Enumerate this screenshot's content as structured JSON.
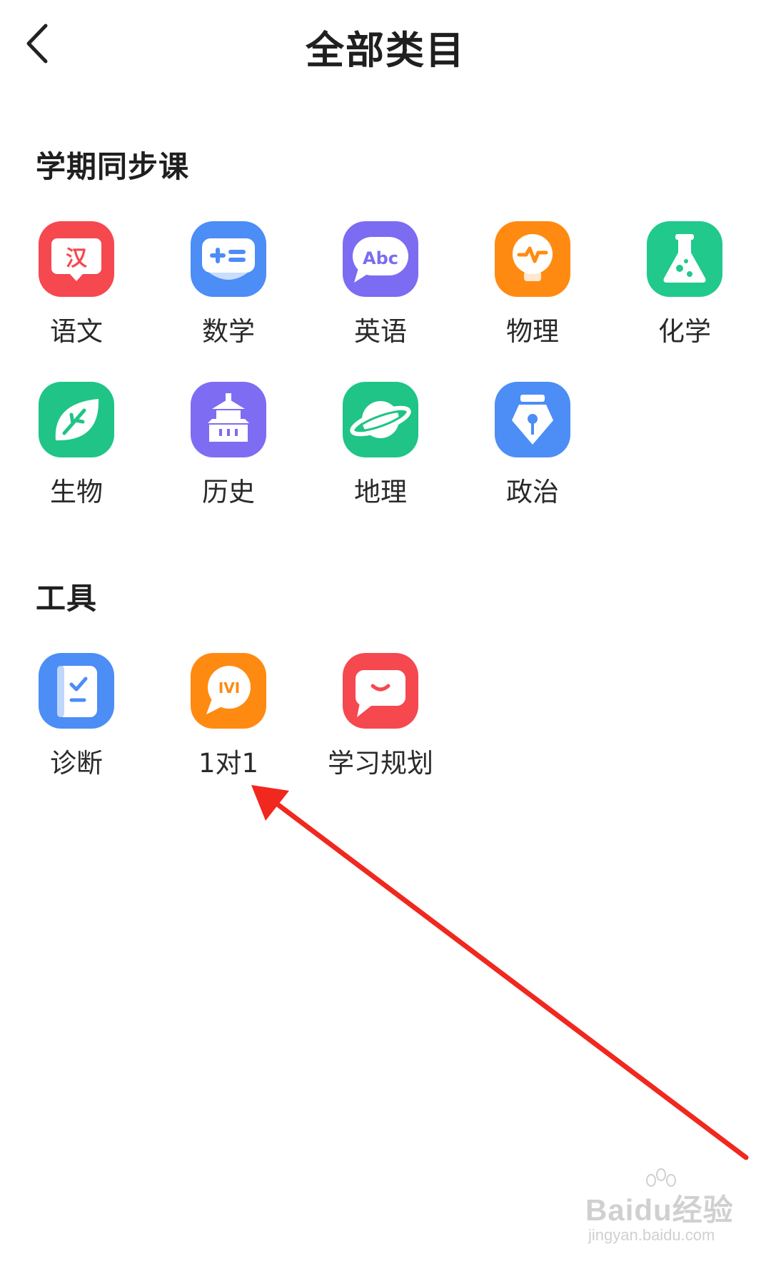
{
  "header": {
    "title": "全部类目",
    "back_icon": "chevron-left-icon"
  },
  "sections": [
    {
      "title": "学期同步课",
      "items": [
        {
          "label": "语文",
          "icon": "book-han-icon",
          "color": "#F5484F",
          "glyph": "汉"
        },
        {
          "label": "数学",
          "icon": "plus-equals-icon",
          "color": "#4C8DF6"
        },
        {
          "label": "英语",
          "icon": "abc-bubble-icon",
          "color": "#7B6CF2",
          "glyph": "Abc"
        },
        {
          "label": "物理",
          "icon": "bulb-pulse-icon",
          "color": "#FF8A12"
        },
        {
          "label": "化学",
          "icon": "flask-icon",
          "color": "#21C98C"
        },
        {
          "label": "生物",
          "icon": "leaf-icon",
          "color": "#1FC486"
        },
        {
          "label": "历史",
          "icon": "temple-icon",
          "color": "#7E6CF2"
        },
        {
          "label": "地理",
          "icon": "planet-icon",
          "color": "#1FC486"
        },
        {
          "label": "政治",
          "icon": "pen-nib-icon",
          "color": "#4C8DF6"
        }
      ]
    },
    {
      "title": "工具",
      "items": [
        {
          "label": "诊断",
          "icon": "clipboard-check-icon",
          "color": "#4C8DF6"
        },
        {
          "label": "1对1",
          "icon": "chat-ivi-icon",
          "color": "#FF8A12",
          "glyph": "IVI"
        },
        {
          "label": "学习规划",
          "icon": "smile-chat-icon",
          "color": "#F5484F"
        }
      ]
    }
  ],
  "annotation": {
    "type": "red-arrow",
    "color": "#F0281E"
  },
  "watermark": {
    "main": "Baidu经验",
    "sub": "jingyan.baidu.com"
  }
}
